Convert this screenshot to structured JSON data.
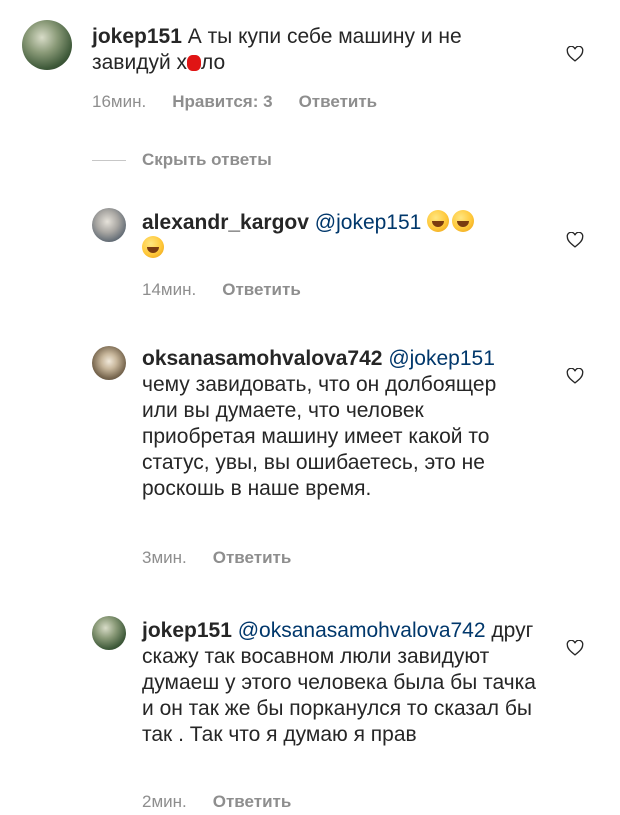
{
  "comments": [
    {
      "username": "jokep151",
      "text_before": " А ты купи себе машину и не завидуй х",
      "text_after": "ло",
      "time": "16мин.",
      "likes": "Нравится: 3",
      "reply": "Ответить"
    },
    {
      "username": "alexandr_kargov",
      "mention": "@jokep151",
      "time": "14мин.",
      "reply": "Ответить"
    },
    {
      "username": "oksanasamohvalova742",
      "mention": "@jokep151",
      "text": "чему завидовать, что он долбоящер или вы думаете, что человек приобретая машину имеет какой то статус, увы, вы ошибаетесь, это не роскошь в наше время.",
      "time": "3мин.",
      "reply": "Ответить"
    },
    {
      "username": "jokep151",
      "mention": "@oksanasamohvalova742",
      "text": "друг скажу так восавном люли завидуют думаеш у этого человека была бы тачка и он так же бы порканулся то сказал бы так . Так что я думаю я прав",
      "time": "2мин.",
      "reply": "Ответить"
    }
  ],
  "hide_replies": "Скрыть ответы",
  "icons": {
    "like": "heart-outline-icon",
    "emoji": "rolling-on-floor-laughing-emoji"
  },
  "colors": {
    "mention": "#00376b",
    "meta": "#8e8e8e",
    "censor": "#e01414"
  }
}
